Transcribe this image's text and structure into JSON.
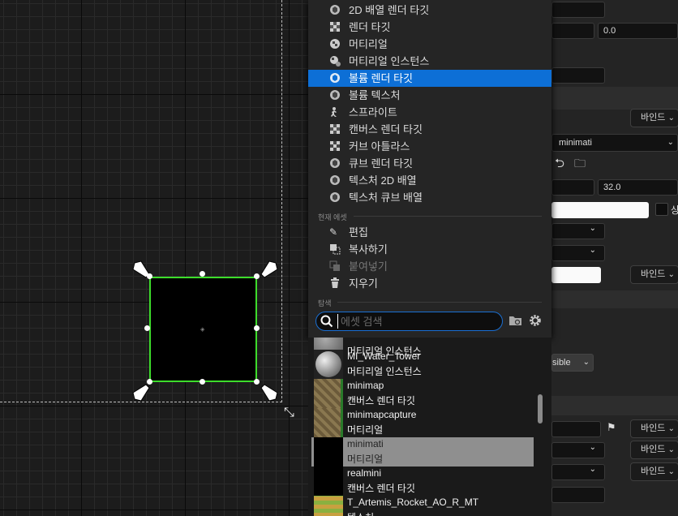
{
  "menu": {
    "items": [
      {
        "label": "2D 배열 렌더 타깃",
        "icon": "render-target-icon"
      },
      {
        "label": "렌더 타깃",
        "icon": "checker-icon"
      },
      {
        "label": "머티리얼",
        "icon": "material-ball-icon"
      },
      {
        "label": "머티리얼 인스턴스",
        "icon": "material-instance-icon"
      },
      {
        "label": "볼륨 렌더 타깃",
        "icon": "render-target-icon",
        "selected": true
      },
      {
        "label": "볼륨 텍스처",
        "icon": "render-target-icon"
      },
      {
        "label": "스프라이트",
        "icon": "sprite-icon"
      },
      {
        "label": "캔버스 렌더 타깃",
        "icon": "checker-icon"
      },
      {
        "label": "커브 아틀라스",
        "icon": "checker-icon"
      },
      {
        "label": "큐브 렌더 타깃",
        "icon": "render-target-icon"
      },
      {
        "label": "텍스처 2D 배열",
        "icon": "render-target-icon"
      },
      {
        "label": "텍스처 큐브 배열",
        "icon": "render-target-icon"
      }
    ],
    "section_current": "현재 에셋",
    "actions": [
      {
        "label": "편집",
        "icon": "pencil-icon",
        "enabled": true
      },
      {
        "label": "복사하기",
        "icon": "copy-icon",
        "enabled": true
      },
      {
        "label": "붙여넣기",
        "icon": "paste-icon",
        "enabled": false
      },
      {
        "label": "지우기",
        "icon": "trash-icon",
        "enabled": true
      }
    ],
    "section_browse": "탐색",
    "search_placeholder": "에셋 검색"
  },
  "assets": [
    {
      "name": "머티리얼 인스턴스",
      "type": ""
    },
    {
      "name": "MI_Water_Tower",
      "type": "머티리얼 인스턴스"
    },
    {
      "name": "minimap",
      "type": "캔버스 렌더 타깃"
    },
    {
      "name": "minimapcapture",
      "type": "머티리얼"
    },
    {
      "name": "minimati",
      "type": "머티리얼",
      "selected": true
    },
    {
      "name": "realmini",
      "type": "캔버스 렌더 타깃"
    },
    {
      "name": "T_Artemis_Rocket_AO_R_MT",
      "type": "텍스처"
    }
  ],
  "details": {
    "field_zero": "0.0",
    "bind_label": "바인드",
    "material_value": "minimati",
    "size_value": "32.0",
    "visibility_value": "sible",
    "checkbox_label": "상"
  },
  "colors": {
    "selection": "#0d6fd6",
    "widget_border": "#3ddc2b",
    "menu_bg": "#252525"
  }
}
